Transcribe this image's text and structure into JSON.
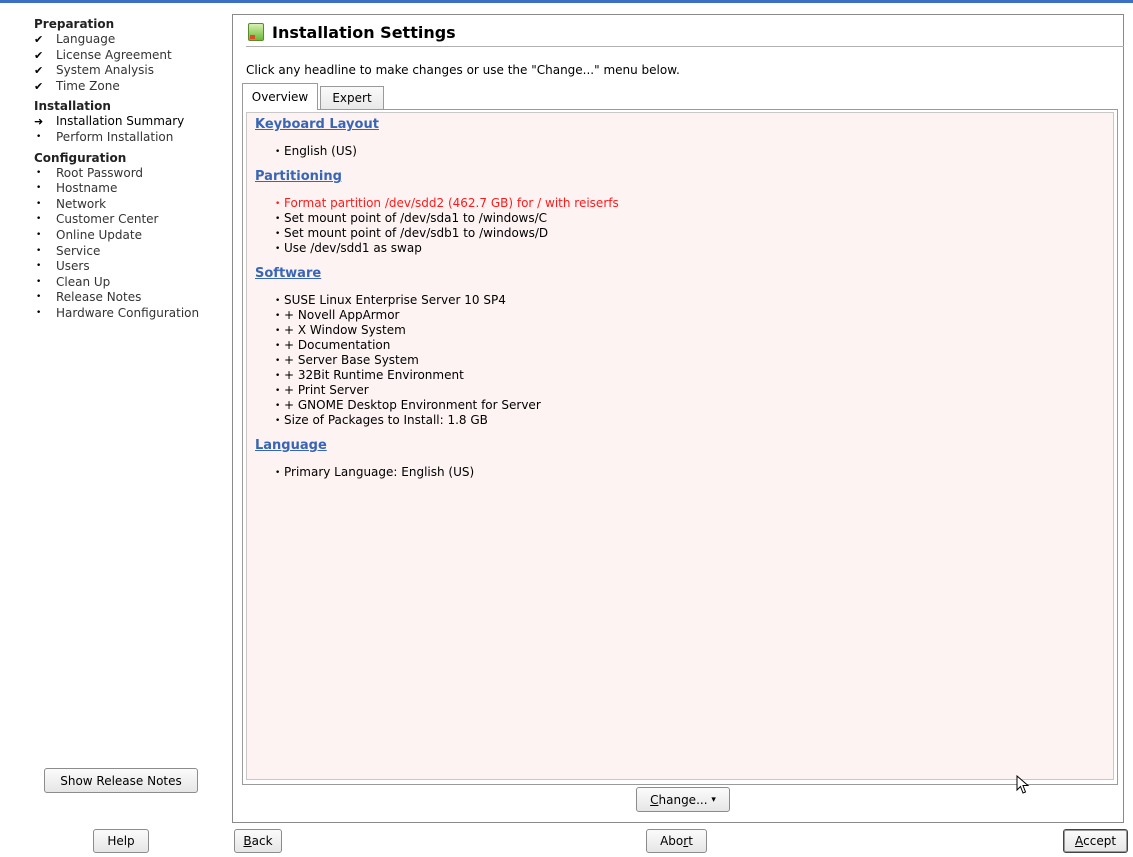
{
  "sidebar": {
    "sections": [
      {
        "heading": "Preparation",
        "items": [
          {
            "label": "Language",
            "state": "done"
          },
          {
            "label": "License Agreement",
            "state": "done"
          },
          {
            "label": "System Analysis",
            "state": "done"
          },
          {
            "label": "Time Zone",
            "state": "done"
          }
        ]
      },
      {
        "heading": "Installation",
        "items": [
          {
            "label": "Installation Summary",
            "state": "current"
          },
          {
            "label": "Perform Installation",
            "state": "pending"
          }
        ]
      },
      {
        "heading": "Configuration",
        "items": [
          {
            "label": "Root Password",
            "state": "pending"
          },
          {
            "label": "Hostname",
            "state": "pending"
          },
          {
            "label": "Network",
            "state": "pending"
          },
          {
            "label": "Customer Center",
            "state": "pending"
          },
          {
            "label": "Online Update",
            "state": "pending"
          },
          {
            "label": "Service",
            "state": "pending"
          },
          {
            "label": "Users",
            "state": "pending"
          },
          {
            "label": "Clean Up",
            "state": "pending"
          },
          {
            "label": "Release Notes",
            "state": "pending"
          },
          {
            "label": "Hardware Configuration",
            "state": "pending"
          }
        ]
      }
    ],
    "show_release_notes_label": "Show Release Notes",
    "help_label": "Help"
  },
  "main": {
    "title": "Installation Settings",
    "intro": "Click any headline to make changes or use the \"Change...\" menu below.",
    "tabs": [
      {
        "label": "Overview",
        "active": true
      },
      {
        "label": "Expert",
        "active": false
      }
    ],
    "sections": [
      {
        "heading": "Keyboard Layout",
        "entries": [
          {
            "text": "English (US)",
            "warning": false
          }
        ]
      },
      {
        "heading": "Partitioning",
        "entries": [
          {
            "text": "Format partition /dev/sdd2 (462.7 GB) for / with reiserfs",
            "warning": true
          },
          {
            "text": "Set mount point of /dev/sda1 to /windows/C",
            "warning": false
          },
          {
            "text": "Set mount point of /dev/sdb1 to /windows/D",
            "warning": false
          },
          {
            "text": "Use /dev/sdd1 as swap",
            "warning": false
          }
        ]
      },
      {
        "heading": "Software",
        "entries": [
          {
            "text": "SUSE Linux Enterprise Server 10 SP4",
            "warning": false
          },
          {
            "text": "+ Novell AppArmor",
            "warning": false
          },
          {
            "text": "+ X Window System",
            "warning": false
          },
          {
            "text": "+ Documentation",
            "warning": false
          },
          {
            "text": "+ Server Base System",
            "warning": false
          },
          {
            "text": "+ 32Bit Runtime Environment",
            "warning": false
          },
          {
            "text": "+ Print Server",
            "warning": false
          },
          {
            "text": "+ GNOME Desktop Environment for Server",
            "warning": false
          },
          {
            "text": "Size of Packages to Install: 1.8 GB",
            "warning": false
          }
        ]
      },
      {
        "heading": "Language",
        "entries": [
          {
            "text": "Primary Language: English (US)",
            "warning": false
          }
        ]
      }
    ],
    "change_button": {
      "mnemonic": "C",
      "rest": "hange...",
      "arrow": "▾"
    }
  },
  "footer": {
    "back": {
      "mnemonic": "B",
      "rest": "ack"
    },
    "abort": {
      "pre": "Abo",
      "mnemonic": "r",
      "rest": "t"
    },
    "accept": {
      "mnemonic": "A",
      "rest": "ccept"
    }
  },
  "colors": {
    "link": "#3865b5",
    "warning": "#ff1a1a",
    "content_bg": "#fdf3f3",
    "top_bar": "#3a6fc4"
  },
  "icons": {
    "done": "checkmark-icon",
    "current": "arrow-right-icon",
    "pending": "bullet-icon",
    "title": "installation-settings-icon"
  }
}
